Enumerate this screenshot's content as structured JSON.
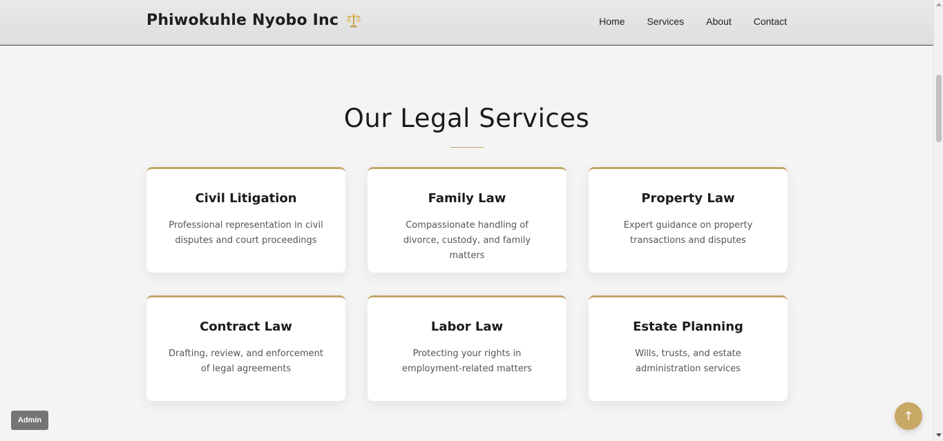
{
  "header": {
    "brand": "Phiwokuhle Nyobo Inc",
    "brand_icon": "balance-scale-icon",
    "nav": [
      "Home",
      "Services",
      "About",
      "Contact"
    ]
  },
  "services": {
    "title": "Our Legal Services",
    "cards": [
      {
        "title": "Civil Litigation",
        "description": "Professional representation in civil disputes and court proceedings"
      },
      {
        "title": "Family Law",
        "description": "Compassionate handling of divorce, custody, and family matters"
      },
      {
        "title": "Property Law",
        "description": "Expert guidance on property transactions and disputes"
      },
      {
        "title": "Contract Law",
        "description": "Drafting, review, and enforcement of legal agreements"
      },
      {
        "title": "Labor Law",
        "description": "Protecting your rights in employment-related matters"
      },
      {
        "title": "Estate Planning",
        "description": "Wills, trusts, and estate administration services"
      }
    ]
  },
  "admin_label": "Admin",
  "back_to_top_icon": "arrow-up-icon",
  "colors": {
    "accent": "#c8a865",
    "background": "#f4f4f4",
    "card": "#ffffff"
  }
}
